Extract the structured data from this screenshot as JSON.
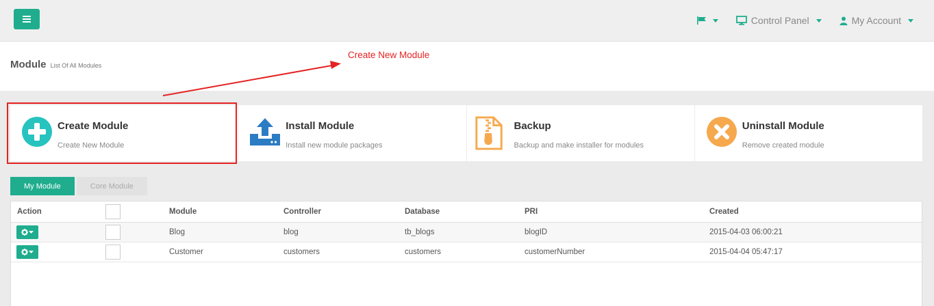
{
  "topbar": {
    "menu_icon": "hamburger-icon",
    "nav": {
      "language_icon": "flag-icon",
      "control_panel_label": "Control Panel",
      "control_panel_icon": "monitor-icon",
      "account_label": "My Account",
      "account_icon": "user-icon"
    }
  },
  "header": {
    "title": "Module",
    "subtitle": "List Of All Modules"
  },
  "annotation": {
    "text": "Create New Module",
    "color": "#e52222"
  },
  "cards": [
    {
      "title": "Create Module",
      "desc": "Create New Module",
      "icon": "plus-circle-icon",
      "color": "#26c3bf"
    },
    {
      "title": "Install Module",
      "desc": "Install new module packages",
      "icon": "upload-icon",
      "color": "#2c7cc4"
    },
    {
      "title": "Backup",
      "desc": "Backup and make installer for modules",
      "icon": "zip-file-icon",
      "color": "#f6a84d"
    },
    {
      "title": "Uninstall Module",
      "desc": "Remove created module",
      "icon": "x-circle-icon",
      "color": "#f6a84d"
    }
  ],
  "tabs": [
    {
      "label": "My Module",
      "active": true
    },
    {
      "label": "Core Module",
      "active": false
    }
  ],
  "table": {
    "headers": {
      "action": "Action",
      "module": "Module",
      "controller": "Controller",
      "database": "Database",
      "pri": "PRI",
      "created": "Created"
    },
    "rows": [
      {
        "module": "Blog",
        "controller": "blog",
        "database": "tb_blogs",
        "pri": "blogID",
        "created": "2015-04-03 06:00:21"
      },
      {
        "module": "Customer",
        "controller": "customers",
        "database": "customers",
        "pri": "customerNumber",
        "created": "2015-04-04 05:47:17"
      }
    ]
  },
  "colors": {
    "accent": "#1fad8e",
    "highlight": "#e52222"
  }
}
